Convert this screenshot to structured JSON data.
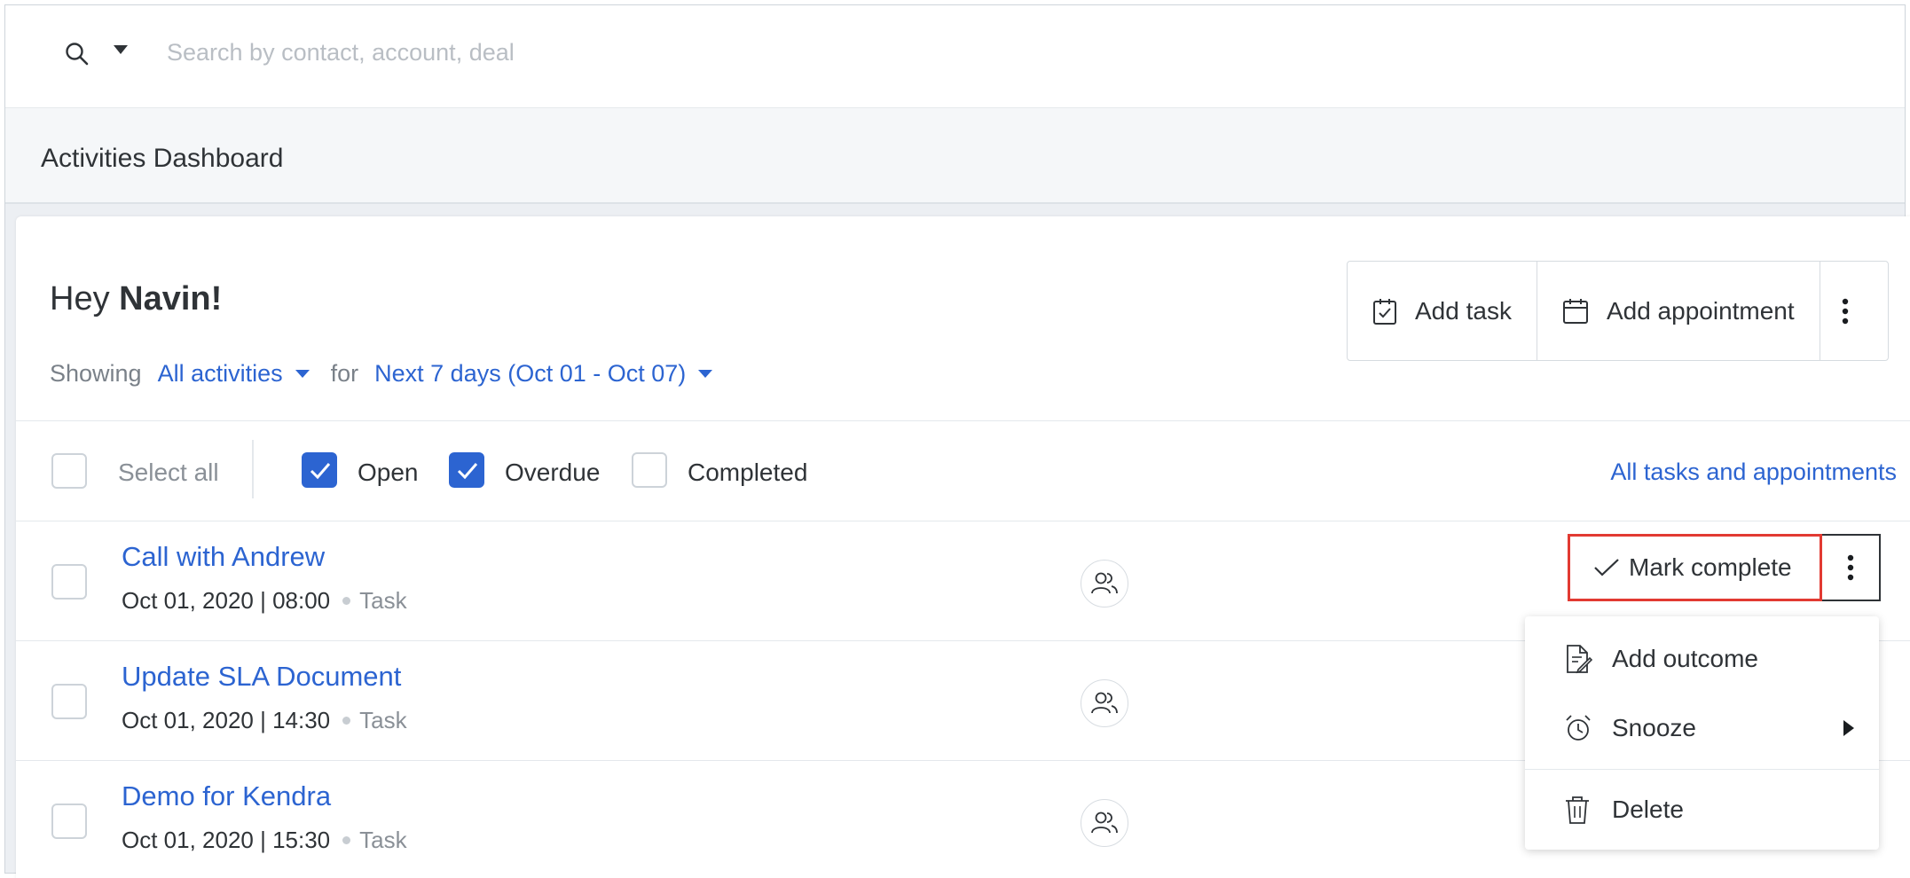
{
  "search": {
    "placeholder": "Search by contact, account, deal"
  },
  "header": {
    "title": "Activities Dashboard"
  },
  "greeting": {
    "prefix": "Hey",
    "name": "Navin!"
  },
  "actions": {
    "add_task": "Add task",
    "add_appointment": "Add appointment"
  },
  "filters": {
    "showing_label": "Showing",
    "activity_filter": "All activities",
    "for_label": "for",
    "date_filter": "Next 7 days (Oct 01 - Oct 07)"
  },
  "status_filters": {
    "select_all": "Select all",
    "open": "Open",
    "overdue": "Overdue",
    "completed": "Completed",
    "open_checked": true,
    "overdue_checked": true,
    "completed_checked": false
  },
  "all_link": "All tasks and appointments",
  "activities": [
    {
      "title": "Call with Andrew",
      "date": "Oct 01, 2020 | 08:00",
      "type": "Task"
    },
    {
      "title": "Update SLA Document",
      "date": "Oct 01, 2020 | 14:30",
      "type": "Task"
    },
    {
      "title": "Demo for Kendra",
      "date": "Oct 01, 2020 | 15:30",
      "type": "Task"
    }
  ],
  "row_actions": {
    "mark_complete": "Mark complete"
  },
  "menu": {
    "add_outcome": "Add outcome",
    "snooze": "Snooze",
    "delete": "Delete"
  },
  "colors": {
    "accent": "#2c64d1",
    "highlight": "#e23a32",
    "text": "#2f3337",
    "muted": "#8a9097"
  }
}
